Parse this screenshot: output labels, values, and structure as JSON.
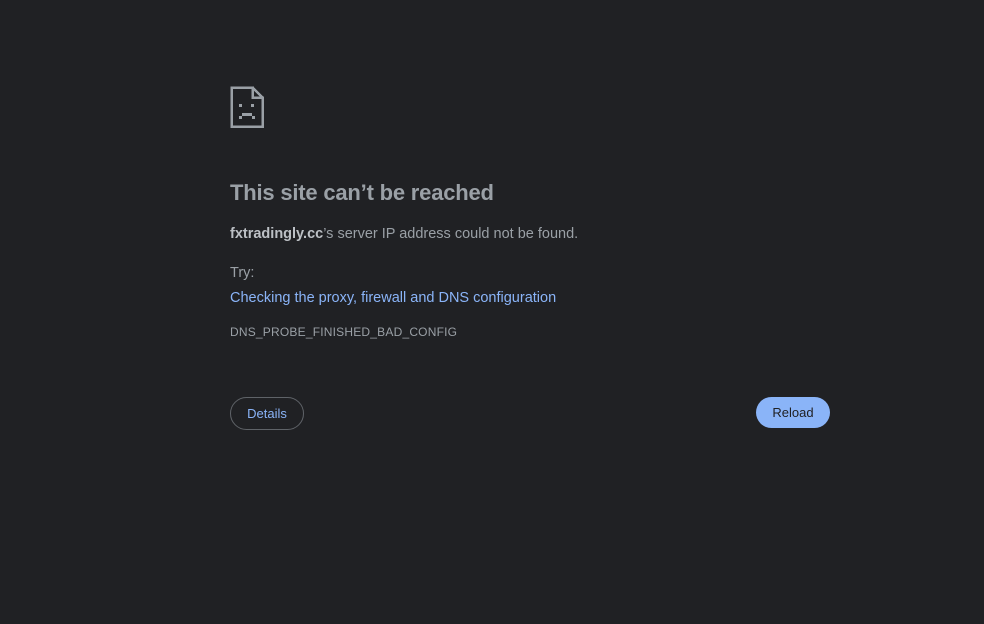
{
  "error_page": {
    "icon": "sad-page-icon",
    "title": "This site can’t be reached",
    "host": "fxtradingly.cc",
    "message_suffix": "’s server IP address could not be found.",
    "try_label": "Try:",
    "suggestion_link": "Checking the proxy, firewall and DNS configuration",
    "error_code": "DNS_PROBE_FINISHED_BAD_CONFIG"
  },
  "buttons": {
    "details_label": "Details",
    "reload_label": "Reload"
  },
  "colors": {
    "background": "#202124",
    "text": "#9aa0a6",
    "link": "#8ab4f8",
    "button_primary": "#8ab4f8"
  }
}
